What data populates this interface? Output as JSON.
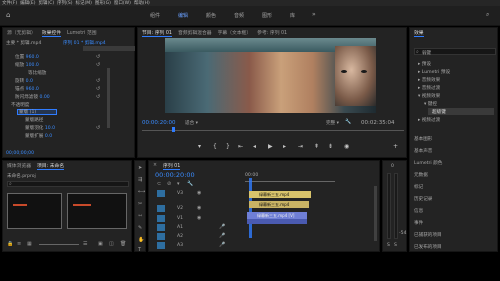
{
  "menu": [
    "文件(F)",
    "编辑(E)",
    "剪辑(C)",
    "序列(S)",
    "标记(M)",
    "图形(G)",
    "窗口(W)",
    "帮助(H)"
  ],
  "workspaces": [
    "组件",
    "编辑",
    "颜色",
    "音频",
    "图形",
    "库"
  ],
  "active_workspace": "编辑",
  "effects_controls": {
    "tabs": [
      "源（无剪辑）",
      "效果控件",
      "序列 01 / 效果...",
      "Lumetri 范围"
    ],
    "clip_label": "主要 * 剪辑.mp4",
    "seq_label": "序列 01 * 剪辑.mp4",
    "motion_rows": [
      {
        "label": "位置",
        "value": "960.0"
      },
      {
        "label": "缩放",
        "value": "100.0"
      },
      {
        "label": "等比缩放",
        "value": ""
      },
      {
        "label": "旋转",
        "value": "0.0"
      },
      {
        "label": "锚点",
        "value": "960.0"
      },
      {
        "label": "防闪烁滤镜",
        "value": "0.00"
      },
      {
        "label": "不透明度",
        "value": ""
      },
      {
        "label": "蒙版 (1)",
        "value": ""
      },
      {
        "label": "蒙版路径",
        "value": ""
      },
      {
        "label": "蒙版羽化",
        "value": "10.0"
      },
      {
        "label": "蒙版扩展",
        "value": "0.0"
      }
    ],
    "time": "00;00;00;00"
  },
  "program_monitor": {
    "tabs": [
      "节目: 序列 01",
      "音频剪辑混合器",
      "字幕（文本框）",
      "参考: 序列 01"
    ],
    "timecode": "00:00:20:00",
    "zoom": "适合",
    "quality": "完整",
    "duration": "00:02:35:04"
  },
  "project": {
    "tabs": [
      "媒体浏览器",
      "项目: 未命名"
    ],
    "file": "未命名.prproj"
  },
  "timeline": {
    "tab": "序列 01",
    "timecode": "00:00:20:00",
    "ruler_mark": "00:00",
    "tracks": [
      "V3",
      "V2",
      "V1",
      "A1",
      "A2",
      "A3"
    ],
    "clips": [
      {
        "name": "绿幕新三五.mp4",
        "track": "V3"
      },
      {
        "name": "绿幕新三五.mp4",
        "track": "V2"
      },
      {
        "name": "绿幕新三五.mp4 [V]",
        "track": "V1"
      }
    ]
  },
  "effects_panel": {
    "tabs": [
      "效果"
    ],
    "search_placeholder": "弱键",
    "tree": [
      "预设",
      "Lumetri 预设",
      "音频效果",
      "音频过渡",
      "视频效果",
      "键控",
      "超级键",
      "视频过渡"
    ],
    "selected": "超级键",
    "sections": [
      "基本图形",
      "基本声音",
      "Lumetri 颜色",
      "元数据",
      "标记",
      "历史记录",
      "信息",
      "事件",
      "已捕获的项目",
      "已发布的项目"
    ]
  },
  "audio_meter": {
    "top_db": "0",
    "bottom_db": "-54",
    "labels": [
      "S",
      "S"
    ]
  },
  "colors": {
    "accent": "#2f7cff",
    "panel": "#232323",
    "clip_yellow": "#d9c36b",
    "clip_blue": "#6f7fd6"
  }
}
